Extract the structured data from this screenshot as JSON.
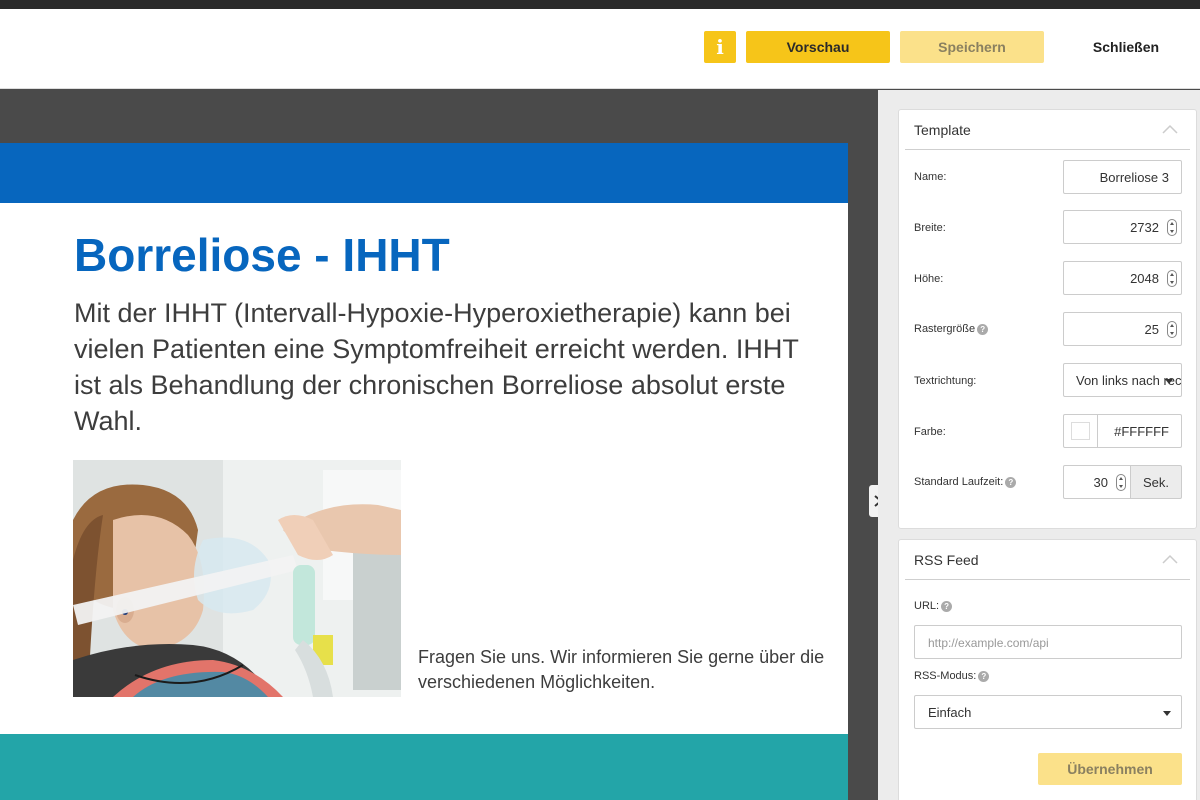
{
  "header": {
    "info_icon": "info-icon",
    "preview_label": "Vorschau",
    "save_label": "Speichern",
    "close_label": "Schließen"
  },
  "slide": {
    "title": "Borreliose - IHHT",
    "body": "Mit der IHHT (Intervall-Hypoxie-Hyperoxietherapie) kann bei vielen Patienten eine Symptomfreiheit erreicht werden. IHHT ist als Behandlung der chronischen Borreliose absolut erste Wahl.",
    "caption": "Fragen Sie uns. Wir informieren Sie gerne über die verschiedenen Möglichkeiten.",
    "top_bar_color": "#0766be",
    "bottom_bar_color": "#23a5a8"
  },
  "template_panel": {
    "title": "Template",
    "name_label": "Name:",
    "name_value": "Borreliose 3",
    "width_label": "Breite:",
    "width_value": "2732",
    "height_label": "Höhe:",
    "height_value": "2048",
    "grid_label": "Rastergröße",
    "grid_value": "25",
    "direction_label": "Textrichtung:",
    "direction_value": "Von links nach rechts",
    "color_label": "Farbe:",
    "color_value": "#FFFFFF",
    "duration_label": "Standard Laufzeit:",
    "duration_value": "30",
    "duration_unit": "Sek."
  },
  "rss_panel": {
    "title": "RSS Feed",
    "url_label": "URL:",
    "url_placeholder": "http://example.com/api",
    "mode_label": "RSS-Modus:",
    "mode_value": "Einfach",
    "apply_label": "Übernehmen"
  },
  "colors": {
    "accent": "#f6c519",
    "accent_disabled": "#fbe18a"
  }
}
